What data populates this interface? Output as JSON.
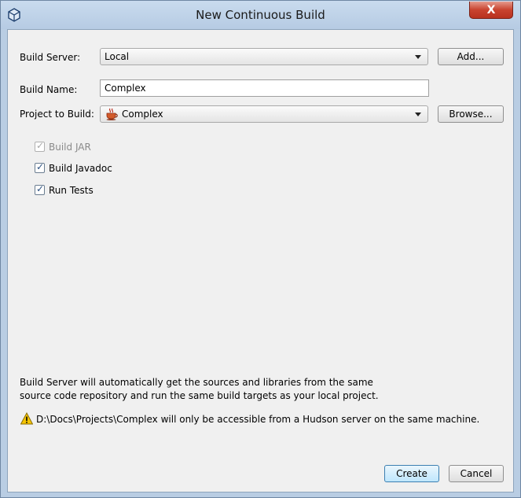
{
  "window": {
    "title": "New Continuous Build",
    "close_label": "X"
  },
  "form": {
    "build_server": {
      "label": "Build Server:",
      "value": "Local",
      "add_label": "Add..."
    },
    "build_name": {
      "label": "Build Name:",
      "value": "Complex"
    },
    "project": {
      "label": "Project to Build:",
      "value": "Complex",
      "browse_label": "Browse..."
    }
  },
  "options": [
    {
      "label": "Build JAR",
      "checked": true,
      "enabled": false
    },
    {
      "label": "Build Javadoc",
      "checked": true,
      "enabled": true
    },
    {
      "label": "Run Tests",
      "checked": true,
      "enabled": true
    }
  ],
  "info_text": {
    "line1": "Build Server will automatically get the sources and libraries from the same",
    "line2": "source code repository and run the same build targets as your local project."
  },
  "warning_text": "D:\\Docs\\Projects\\Complex will only be accessible from a Hudson server on the same machine.",
  "buttons": {
    "create": "Create",
    "cancel": "Cancel"
  },
  "colors": {
    "warning": "#f5c400",
    "close": "#c9432f",
    "accent": "#3c7fb1"
  }
}
